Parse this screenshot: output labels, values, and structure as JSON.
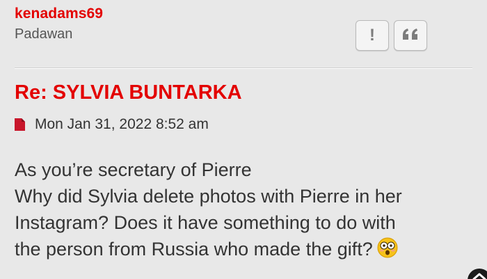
{
  "post": {
    "author": {
      "username": "kenadams69",
      "rank": "Padawan"
    },
    "actions": {
      "report_glyph": "!",
      "quote_glyph": "❝"
    },
    "title": "Re: SYLVIA BUNTARKA",
    "timestamp": "Mon Jan 31, 2022 8:52 am",
    "content_lines": [
      "As you’re secretary of Pierre",
      "Why did Sylvia delete photos with Pierre in her",
      "Instagram? Does it have something to do with",
      "the person from Russia who made the gift?"
    ],
    "emoji": "flushed-face-icon"
  },
  "colors": {
    "accent": "#e30000",
    "background": "#e8e8e8",
    "text": "#333333",
    "muted": "#555555",
    "button_glyph": "#7c7c7c"
  }
}
